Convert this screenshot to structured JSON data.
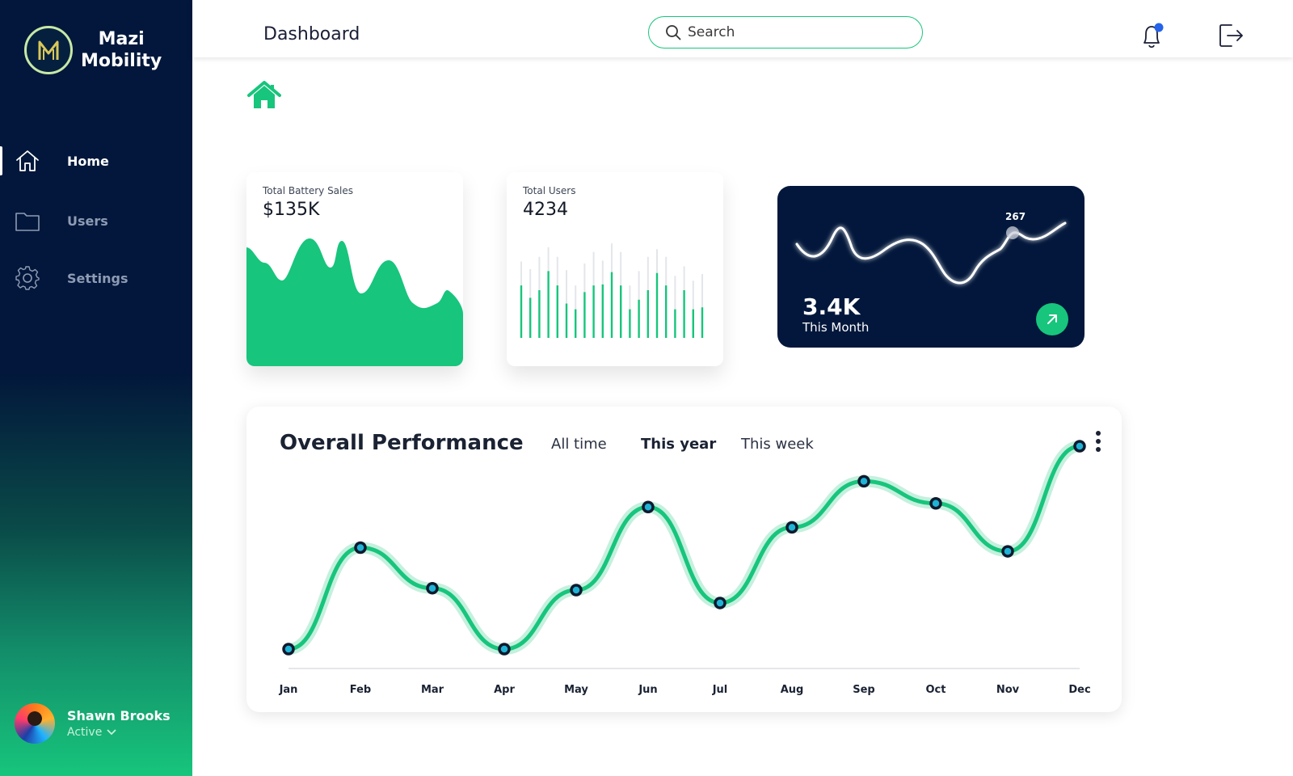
{
  "app": {
    "name_line1": "Mazi",
    "name_line2": "Mobility"
  },
  "sidebar": {
    "items": [
      {
        "label": "Home",
        "icon": "home-icon",
        "active": true
      },
      {
        "label": "Users",
        "icon": "folder-icon",
        "active": false
      },
      {
        "label": "Settings",
        "icon": "gear-icon",
        "active": false
      }
    ]
  },
  "profile": {
    "name": "Shawn Brooks",
    "status": "Active"
  },
  "header": {
    "title": "Dashboard",
    "search_placeholder": "Search"
  },
  "cards": {
    "battery": {
      "label": "Total Battery Sales",
      "value": "$135K"
    },
    "users": {
      "label": "Total Users",
      "value": "4234"
    },
    "monthly": {
      "value": "3.4K",
      "label": "This Month",
      "peak": "267"
    }
  },
  "performance": {
    "title": "Overall Performance",
    "tabs": [
      "All time",
      "This year",
      "This week"
    ],
    "selected_tab": "This year",
    "months": [
      "Jan",
      "Feb",
      "Mar",
      "Apr",
      "May",
      "Jun",
      "Jul",
      "Aug",
      "Sep",
      "Oct",
      "Nov",
      "Dec"
    ],
    "values": [
      5,
      60,
      38,
      5,
      37,
      82,
      30,
      71,
      96,
      84,
      58,
      115
    ]
  },
  "colors": {
    "accent": "#17c57c",
    "navy": "#02173b",
    "notification": "#2563eb"
  }
}
